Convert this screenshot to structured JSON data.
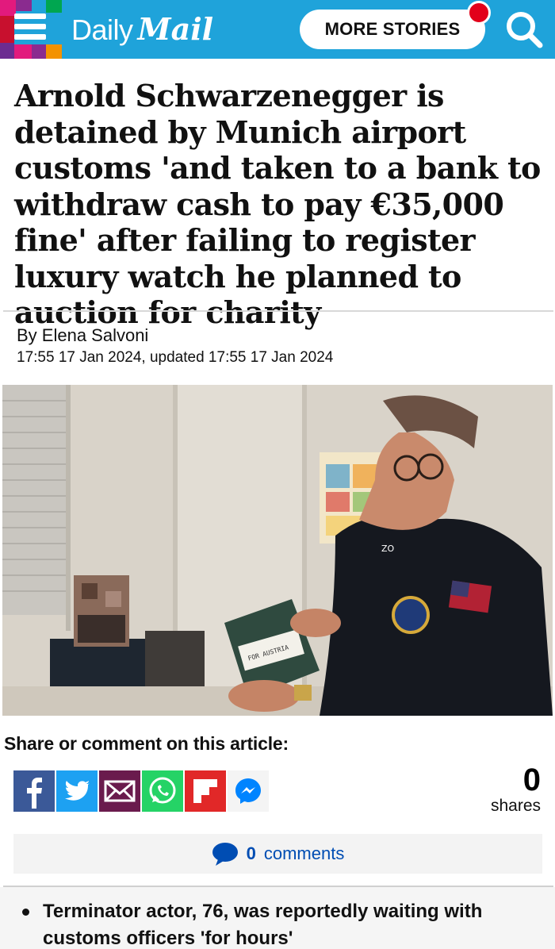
{
  "header": {
    "brand_daily": "Daily",
    "brand_mail": "Mail",
    "more_stories_label": "MORE STORIES",
    "colors": {
      "bar": "#1fa3da",
      "notification": "#e2001a"
    }
  },
  "article": {
    "headline": "Arnold Schwarzenegger is detained by Munich airport customs 'and taken to a bank to withdraw cash to pay €35,000 fine' after failing to register luxury watch he planned to auction for charity",
    "byline": "By Elena Salvoni",
    "dateline": "17:55 17 Jan 2024, updated 17:55 17 Jan 2024",
    "photo_box_text": "FOR AUSTRIA",
    "photo_jacket_text": "ZO"
  },
  "share": {
    "heading": "Share or comment on this article:",
    "buttons": [
      {
        "icon": "facebook-icon",
        "color": "#3b5998"
      },
      {
        "icon": "twitter-icon",
        "color": "#1da1f2"
      },
      {
        "icon": "email-icon",
        "color": "#6a1b4d"
      },
      {
        "icon": "whatsapp-icon",
        "color": "#25d366"
      },
      {
        "icon": "flipboard-icon",
        "color": "#e12828"
      },
      {
        "icon": "messenger-icon",
        "color": "#ffffff"
      }
    ],
    "count": "0",
    "count_label": "shares"
  },
  "comments": {
    "count": "0",
    "label": "comments"
  },
  "bullets": [
    "Terminator actor, 76, was reportedly waiting with customs officers 'for hours'"
  ]
}
